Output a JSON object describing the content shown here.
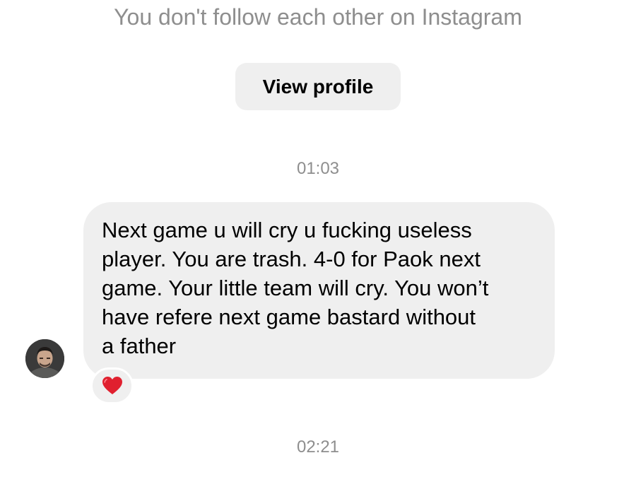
{
  "thread": {
    "follow_note": "You don't follow each other on Instagram",
    "view_profile_label": "View profile"
  },
  "messages": [
    {
      "timestamp": "01:03",
      "sender": "other",
      "lines": [
        "Next game u will cry u fucking useless",
        "player. You are trash. 4-0 for Paok next",
        "game. Your little team will cry. You won’t",
        "have refere next game bastard without",
        "a father"
      ],
      "reaction": "heart-icon"
    }
  ],
  "next_timestamp": "02:21",
  "colors": {
    "muted_text": "#8e8e8e",
    "bubble_bg": "#efefef",
    "heart": "#e0202f"
  }
}
